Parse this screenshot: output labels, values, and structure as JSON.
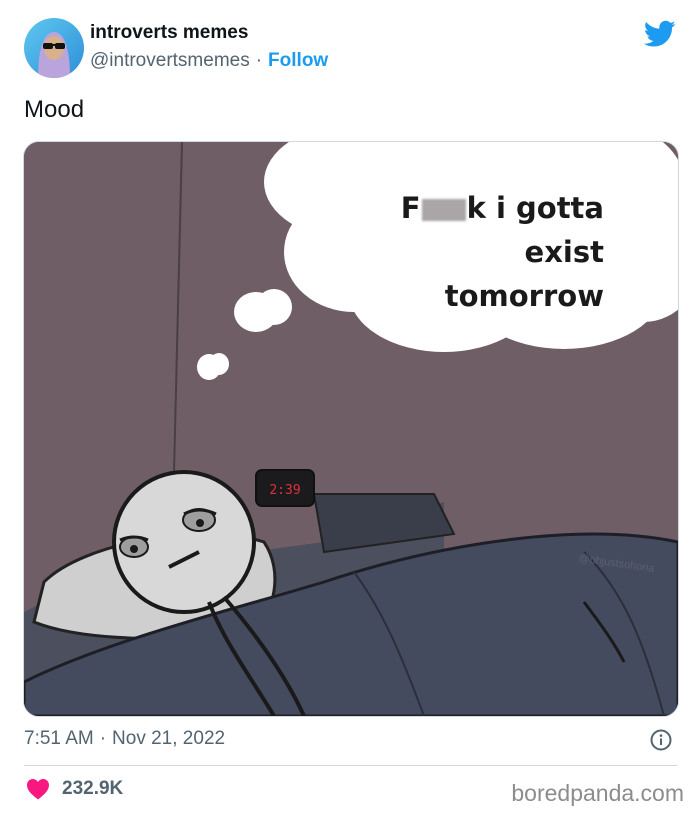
{
  "account": {
    "display_name": "introverts memes",
    "handle": "@introvertsmemes",
    "separator": "·",
    "follow_label": "Follow"
  },
  "tweet": {
    "text": "Mood",
    "time": "7:51 AM",
    "date": "Nov 21, 2022",
    "likes": "232.9K"
  },
  "meme": {
    "line1_start": "F",
    "line1_end": "k i gotta exist",
    "line2": "tomorrow",
    "clock_time": "2:39",
    "signature": "@ohjustsohoria"
  },
  "watermark": "boredpanda.com",
  "colors": {
    "brand_blue": "#1d9bf0",
    "like_red": "#f91880",
    "wall": "#6f5e66",
    "secondary_text": "#536471"
  },
  "icons": [
    "twitter-bird-icon",
    "info-icon",
    "heart-icon"
  ]
}
